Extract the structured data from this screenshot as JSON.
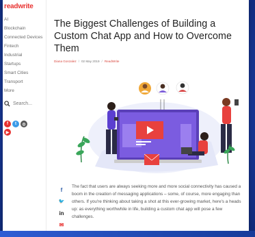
{
  "brand": {
    "logo_text": "readwrite",
    "accent": "#e8312f"
  },
  "sidebar": {
    "items": [
      {
        "label": "AI"
      },
      {
        "label": "Blockchain"
      },
      {
        "label": "Connected Devices"
      },
      {
        "label": "Fintech"
      },
      {
        "label": "Industrial"
      },
      {
        "label": "Startups"
      },
      {
        "label": "Smart Cities"
      },
      {
        "label": "Transport"
      },
      {
        "label": "More"
      }
    ],
    "search_label": "Search...",
    "social": [
      {
        "icon": "facebook-icon",
        "glyph": "f",
        "color": "#e8312f"
      },
      {
        "icon": "twitter-icon",
        "glyph": "t",
        "color": "#3b9be8"
      },
      {
        "icon": "instagram-icon",
        "glyph": "◎",
        "color": "#555555"
      },
      {
        "icon": "youtube-icon",
        "glyph": "▶",
        "color": "#e8312f"
      }
    ]
  },
  "article": {
    "title": "The Biggest Challenges of Building a Custom Chat App and How to Overcome Them",
    "author": "Diana Gonzalez",
    "date": "02 May 2019",
    "publication": "ReadWrite",
    "paragraph": "The fact that users are always seeking more and more social connectivity has caused a boom in the creation of messaging applications – some, of course, more engaging than others. If you're thinking about taking a shot at this ever-growing market, here's a heads up: as everything worthwhile in life, building a custom chat app will pose a few challenges."
  },
  "share": [
    {
      "icon": "facebook-icon",
      "glyph": "f",
      "color": "#2f5ea8"
    },
    {
      "icon": "twitter-icon",
      "glyph": "🐦",
      "color": "#3aa0e8"
    },
    {
      "icon": "linkedin-icon",
      "glyph": "in",
      "color": "#222222"
    },
    {
      "icon": "email-icon",
      "glyph": "✉",
      "color": "#e8312f"
    }
  ]
}
